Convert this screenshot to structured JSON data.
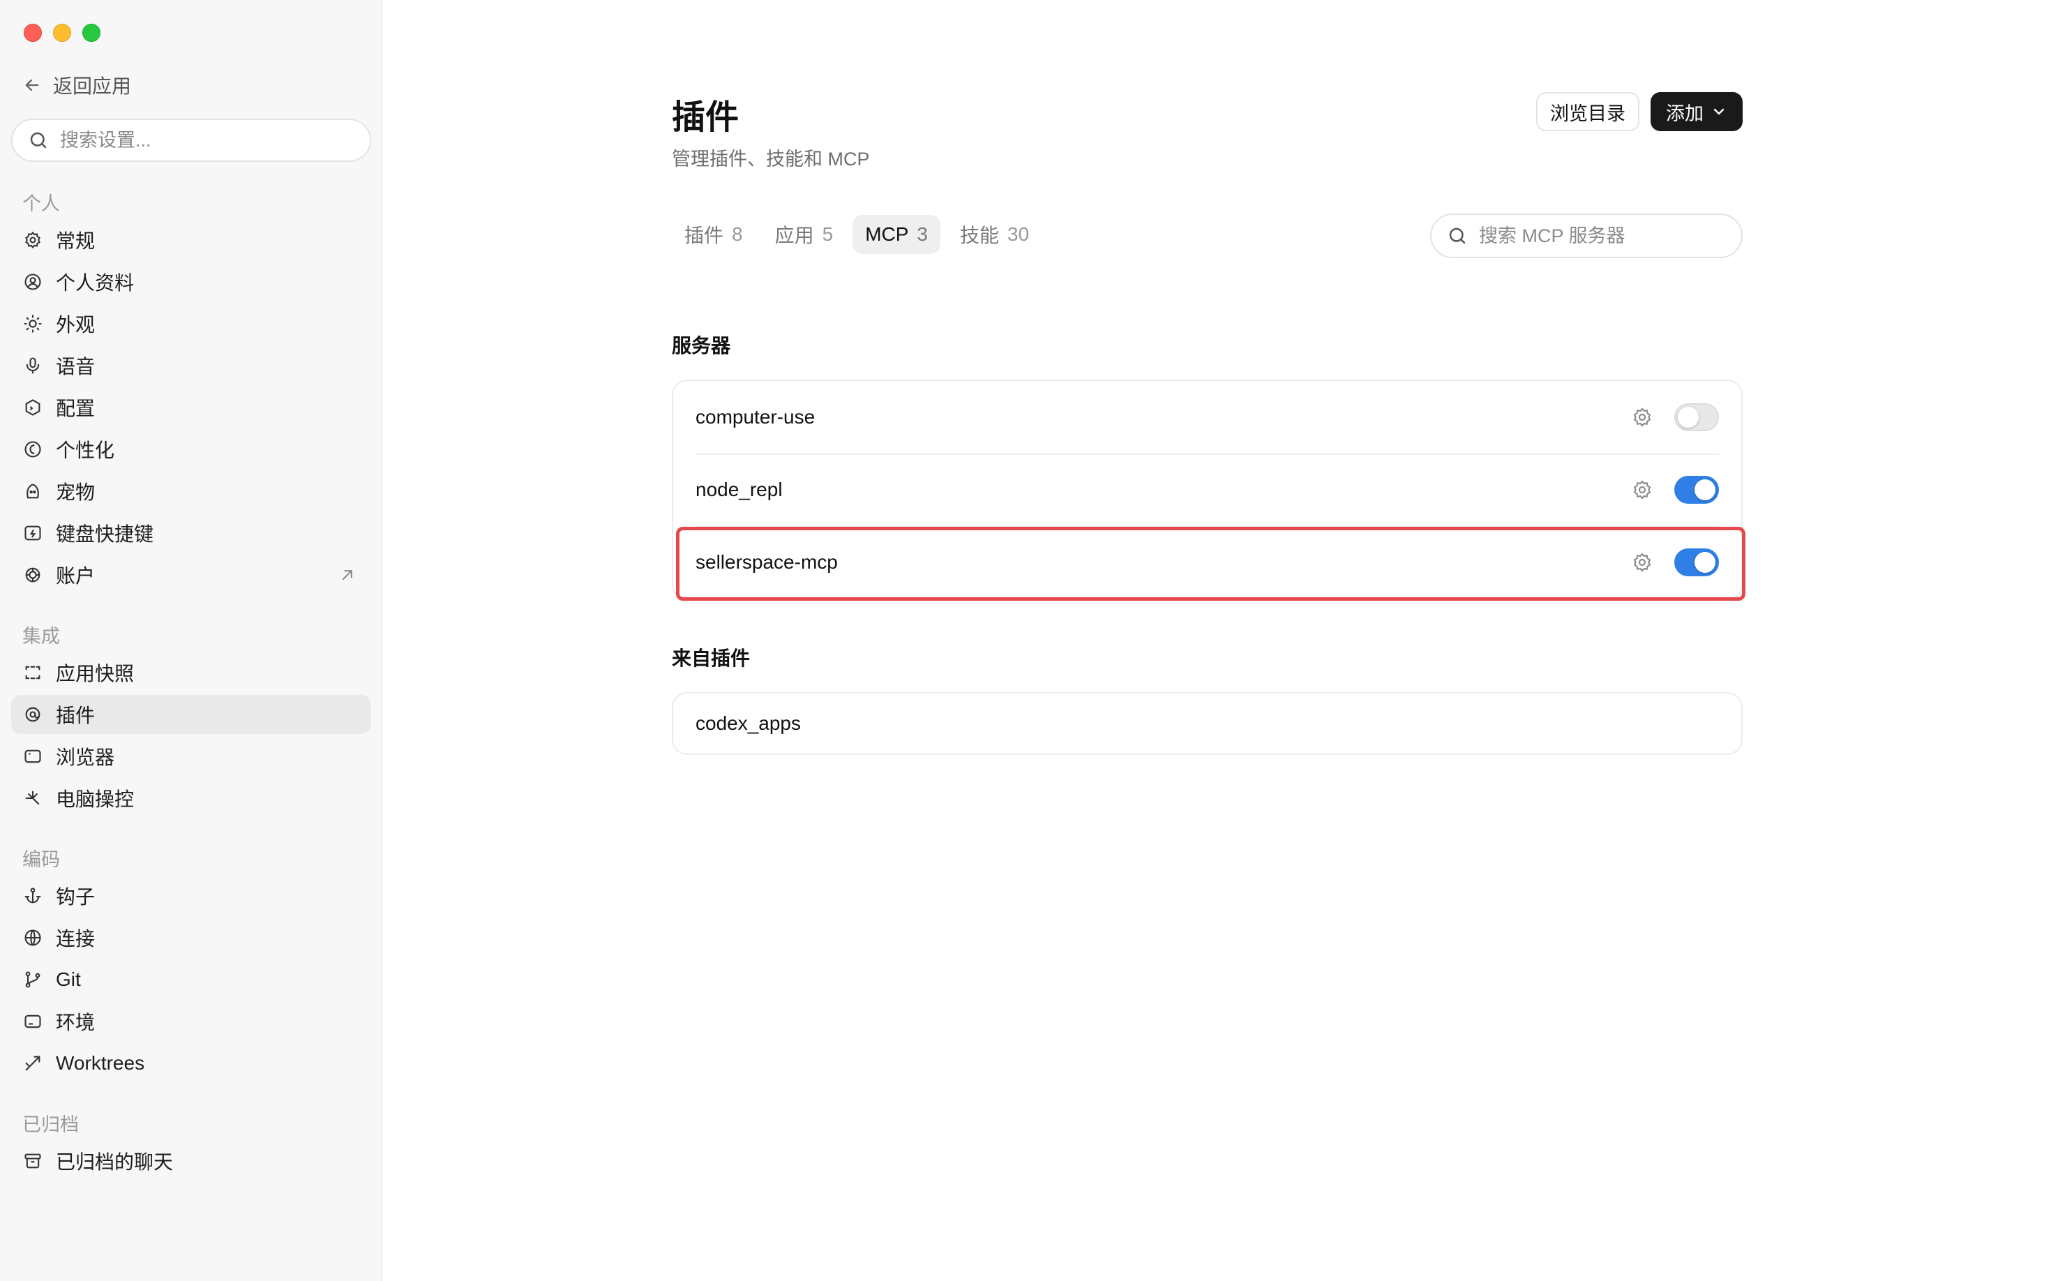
{
  "sidebar": {
    "back_label": "返回应用",
    "search_placeholder": "搜索设置...",
    "groups": {
      "personal": "个人",
      "integration": "集成",
      "coding": "编码",
      "archived": "已归档"
    },
    "items": [
      {
        "label": "常规",
        "icon": "gear-icon"
      },
      {
        "label": "个人资料",
        "icon": "profile-icon"
      },
      {
        "label": "外观",
        "icon": "sun-icon"
      },
      {
        "label": "语音",
        "icon": "microphone-icon"
      },
      {
        "label": "配置",
        "icon": "config-icon"
      },
      {
        "label": "个性化",
        "icon": "personalize-icon"
      },
      {
        "label": "宠物",
        "icon": "pet-icon"
      },
      {
        "label": "键盘快捷键",
        "icon": "keyboard-icon"
      },
      {
        "label": "账户",
        "icon": "account-icon"
      },
      {
        "label": "应用快照",
        "icon": "snapshot-icon"
      },
      {
        "label": "插件",
        "icon": "plugin-icon"
      },
      {
        "label": "浏览器",
        "icon": "browser-icon"
      },
      {
        "label": "电脑操控",
        "icon": "computer-control-icon"
      },
      {
        "label": "钩子",
        "icon": "anchor-icon"
      },
      {
        "label": "连接",
        "icon": "globe-icon"
      },
      {
        "label": "Git",
        "icon": "git-branch-icon"
      },
      {
        "label": "环境",
        "icon": "environment-icon"
      },
      {
        "label": "Worktrees",
        "icon": "worktree-icon"
      },
      {
        "label": "已归档的聊天",
        "icon": "archive-icon"
      }
    ],
    "active_item": "插件"
  },
  "header": {
    "title": "插件",
    "subtitle": "管理插件、技能和 MCP",
    "browse_label": "浏览目录",
    "add_label": "添加"
  },
  "tabs": [
    {
      "label": "插件",
      "count": "8"
    },
    {
      "label": "应用",
      "count": "5"
    },
    {
      "label": "MCP",
      "count": "3"
    },
    {
      "label": "技能",
      "count": "30"
    }
  ],
  "active_tab": "MCP",
  "mcp_search": {
    "placeholder": "搜索 MCP 服务器"
  },
  "servers": {
    "section_title": "服务器",
    "items": [
      {
        "name": "computer-use",
        "enabled": false
      },
      {
        "name": "node_repl",
        "enabled": true
      },
      {
        "name": "sellerspace-mcp",
        "enabled": true
      }
    ],
    "highlighted": "sellerspace-mcp"
  },
  "from_plugins": {
    "section_title": "来自插件",
    "items": [
      {
        "name": "codex_apps"
      }
    ]
  },
  "colors": {
    "accent": "#2f7fe6",
    "highlight": "#e5484d",
    "add_button": "#1a1a1a"
  }
}
